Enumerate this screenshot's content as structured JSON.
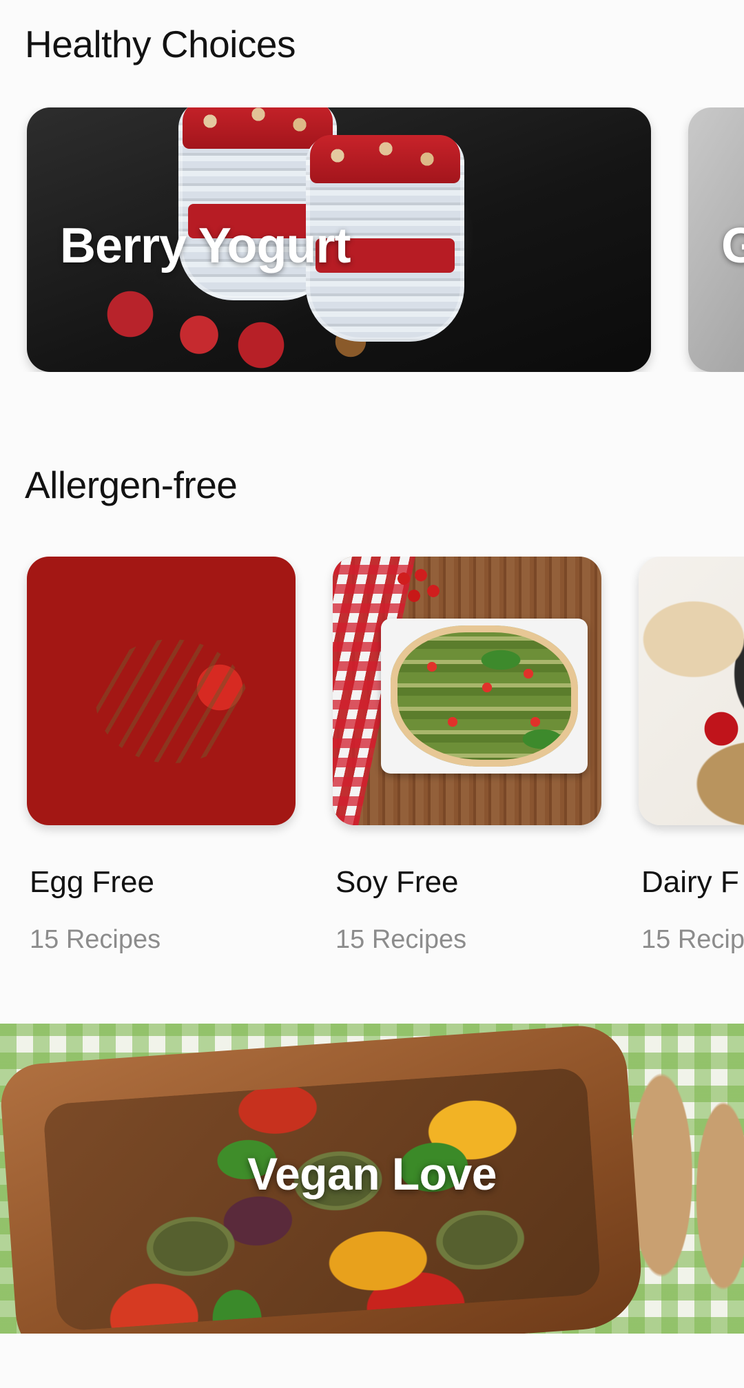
{
  "sections": {
    "healthy_choices": {
      "title": "Healthy Choices",
      "cards": [
        {
          "title": "Berry Yogurt"
        },
        {
          "title": "G"
        }
      ]
    },
    "allergen_free": {
      "title": "Allergen-free",
      "items": [
        {
          "name": "Egg Free",
          "count": "15 Recipes"
        },
        {
          "name": "Soy Free",
          "count": "15 Recipes"
        },
        {
          "name": "Dairy F",
          "count": "15 Recip"
        }
      ]
    },
    "banner": {
      "title": "Vegan Love"
    }
  }
}
